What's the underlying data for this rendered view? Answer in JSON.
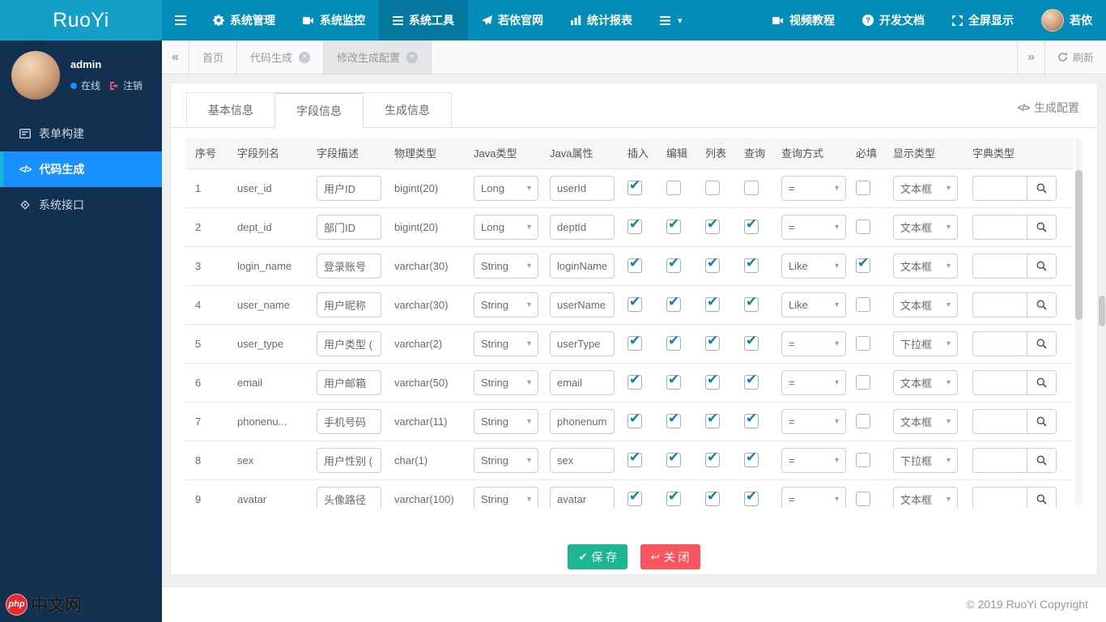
{
  "brand": "RuoYi",
  "navbar": {
    "menu": [
      {
        "label": "系统管理",
        "icon": "gear-icon",
        "active": false
      },
      {
        "label": "系统监控",
        "icon": "monitor-icon",
        "active": false
      },
      {
        "label": "系统工具",
        "icon": "list-icon",
        "active": true
      },
      {
        "label": "若依官网",
        "icon": "paper-plane-icon",
        "active": false
      },
      {
        "label": "统计报表",
        "icon": "bar-chart-icon",
        "active": false
      }
    ],
    "right": [
      {
        "label": "视频教程",
        "icon": "video-icon"
      },
      {
        "label": "开发文档",
        "icon": "question-circle-icon"
      },
      {
        "label": "全屏显示",
        "icon": "expand-icon"
      },
      {
        "label": "若依",
        "icon": "avatar"
      }
    ]
  },
  "sidebar": {
    "user": {
      "name": "admin",
      "status_label": "在线",
      "logout_label": "注销"
    },
    "menu": [
      {
        "label": "表单构建",
        "icon": "form-icon",
        "active": false
      },
      {
        "label": "代码生成",
        "icon": "code-icon",
        "active": true
      },
      {
        "label": "系统接口",
        "icon": "api-icon",
        "active": false
      }
    ]
  },
  "tabbar": {
    "tabs": [
      {
        "label": "首页",
        "closable": false,
        "active": false
      },
      {
        "label": "代码生成",
        "closable": true,
        "active": false
      },
      {
        "label": "修改生成配置",
        "closable": true,
        "active": true
      }
    ],
    "refresh_label": "刷新"
  },
  "panel": {
    "tabs": [
      {
        "label": "基本信息",
        "active": false
      },
      {
        "label": "字段信息",
        "active": true
      },
      {
        "label": "生成信息",
        "active": false
      }
    ],
    "config_link": "生成配置",
    "table": {
      "headers": [
        "序号",
        "字段列名",
        "字段描述",
        "物理类型",
        "Java类型",
        "Java属性",
        "插入",
        "编辑",
        "列表",
        "查询",
        "查询方式",
        "必填",
        "显示类型",
        "字典类型"
      ],
      "rows": [
        {
          "num": "1",
          "col": "user_id",
          "desc": "用户ID",
          "type": "bigint(20)",
          "java": "Long",
          "prop": "userId",
          "insert": true,
          "edit": false,
          "list": false,
          "query": false,
          "qtype": "=",
          "required": false,
          "display": "文本框",
          "dict": ""
        },
        {
          "num": "2",
          "col": "dept_id",
          "desc": "部门ID",
          "type": "bigint(20)",
          "java": "Long",
          "prop": "deptId",
          "insert": true,
          "edit": true,
          "list": true,
          "query": true,
          "qtype": "=",
          "required": false,
          "display": "文本框",
          "dict": ""
        },
        {
          "num": "3",
          "col": "login_name",
          "desc": "登录账号",
          "type": "varchar(30)",
          "java": "String",
          "prop": "loginName",
          "insert": true,
          "edit": true,
          "list": true,
          "query": true,
          "qtype": "Like",
          "required": true,
          "display": "文本框",
          "dict": ""
        },
        {
          "num": "4",
          "col": "user_name",
          "desc": "用户昵称",
          "type": "varchar(30)",
          "java": "String",
          "prop": "userName",
          "insert": true,
          "edit": true,
          "list": true,
          "query": true,
          "qtype": "Like",
          "required": false,
          "display": "文本框",
          "dict": ""
        },
        {
          "num": "5",
          "col": "user_type",
          "desc": "用户类型 (",
          "type": "varchar(2)",
          "java": "String",
          "prop": "userType",
          "insert": true,
          "edit": true,
          "list": true,
          "query": true,
          "qtype": "=",
          "required": false,
          "display": "下拉框",
          "dict": ""
        },
        {
          "num": "6",
          "col": "email",
          "desc": "用户邮箱",
          "type": "varchar(50)",
          "java": "String",
          "prop": "email",
          "insert": true,
          "edit": true,
          "list": true,
          "query": true,
          "qtype": "=",
          "required": false,
          "display": "文本框",
          "dict": ""
        },
        {
          "num": "7",
          "col": "phonenu...",
          "desc": "手机号码",
          "type": "varchar(11)",
          "java": "String",
          "prop": "phonenum",
          "insert": true,
          "edit": true,
          "list": true,
          "query": true,
          "qtype": "=",
          "required": false,
          "display": "文本框",
          "dict": ""
        },
        {
          "num": "8",
          "col": "sex",
          "desc": "用户性别 (",
          "type": "char(1)",
          "java": "String",
          "prop": "sex",
          "insert": true,
          "edit": true,
          "list": true,
          "query": true,
          "qtype": "=",
          "required": false,
          "display": "下拉框",
          "dict": ""
        },
        {
          "num": "9",
          "col": "avatar",
          "desc": "头像路径",
          "type": "varchar(100)",
          "java": "String",
          "prop": "avatar",
          "insert": true,
          "edit": true,
          "list": true,
          "query": true,
          "qtype": "=",
          "required": false,
          "display": "文本框",
          "dict": ""
        }
      ]
    },
    "save_label": "保 存",
    "close_label": "关 闭"
  },
  "footer": {
    "copyright": "© 2019 RuoYi Copyright"
  },
  "watermark": {
    "badge": "php",
    "text": "中文网"
  },
  "colors": {
    "navbar": "#048db8",
    "logo": "#149fc6",
    "sidebar": "#12304f",
    "active_blue": "#1890ff",
    "check_blue": "#1a7bb9",
    "save_green": "#1cb690",
    "close_red": "#f8565f"
  }
}
